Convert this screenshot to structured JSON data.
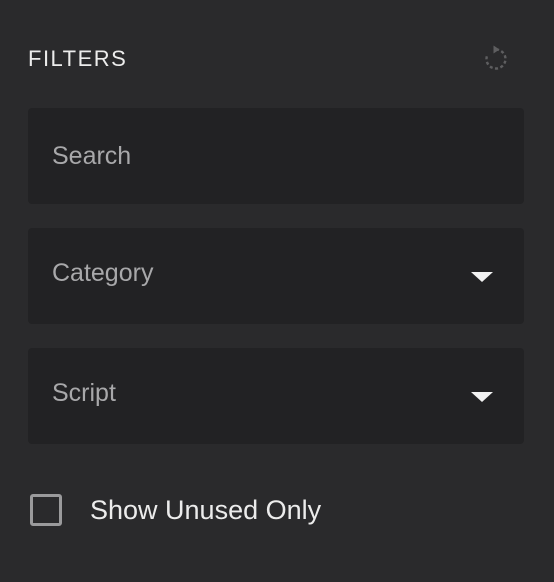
{
  "panel": {
    "title": "FILTERS",
    "reset_icon": "reset-icon"
  },
  "search": {
    "placeholder": "Search",
    "value": ""
  },
  "category": {
    "label": "Category",
    "icon": "chevron-down-icon"
  },
  "script": {
    "label": "Script",
    "icon": "chevron-down-icon"
  },
  "unused_filter": {
    "label": "Show Unused Only",
    "checked": false
  },
  "colors": {
    "background": "#2a2a2c",
    "field_background": "#222224",
    "text": "#ececec",
    "muted_text": "#a8a8aa",
    "icon": "#5e5e60"
  }
}
